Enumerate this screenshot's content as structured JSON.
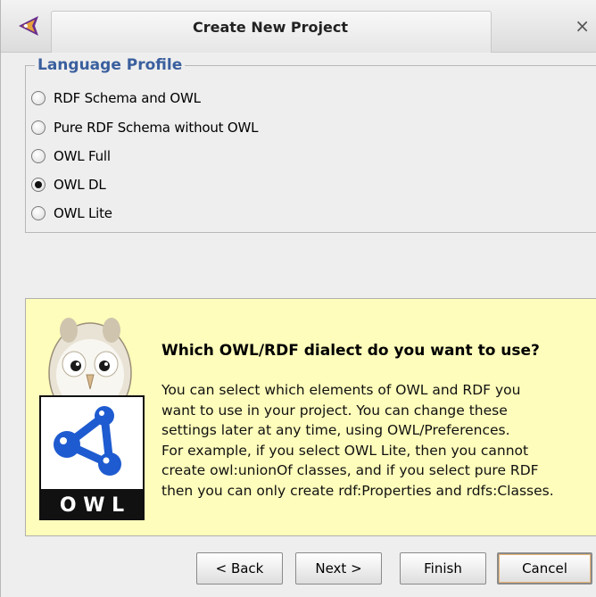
{
  "window": {
    "title": "Create New Project",
    "close_glyph": "×"
  },
  "language_profile": {
    "legend": "Language Profile",
    "options": [
      {
        "label": "RDF Schema and OWL",
        "checked": false
      },
      {
        "label": "Pure RDF Schema without OWL",
        "checked": false
      },
      {
        "label": "OWL Full",
        "checked": false
      },
      {
        "label": "OWL DL",
        "checked": true
      },
      {
        "label": "OWL Lite",
        "checked": false
      }
    ]
  },
  "info": {
    "heading": "Which OWL/RDF dialect do you want to use?",
    "lines": [
      "You can select which elements of OWL and RDF you",
      "want to use in your project. You can change these",
      "settings later at any time, using OWL/Preferences.",
      "For example, if you select OWL Lite, then you cannot",
      "create owl:unionOf classes, and if you select pure RDF",
      "then you can only create rdf:Properties and rdfs:Classes."
    ],
    "mascot_logo_text": "O W L"
  },
  "buttons": {
    "back": "< Back",
    "next": "Next >",
    "finish": "Finish",
    "cancel": "Cancel"
  },
  "colors": {
    "legend": "#3a5f9e",
    "info_background": "#fefdbb",
    "owl_logo_blue": "#1e5bd0"
  }
}
